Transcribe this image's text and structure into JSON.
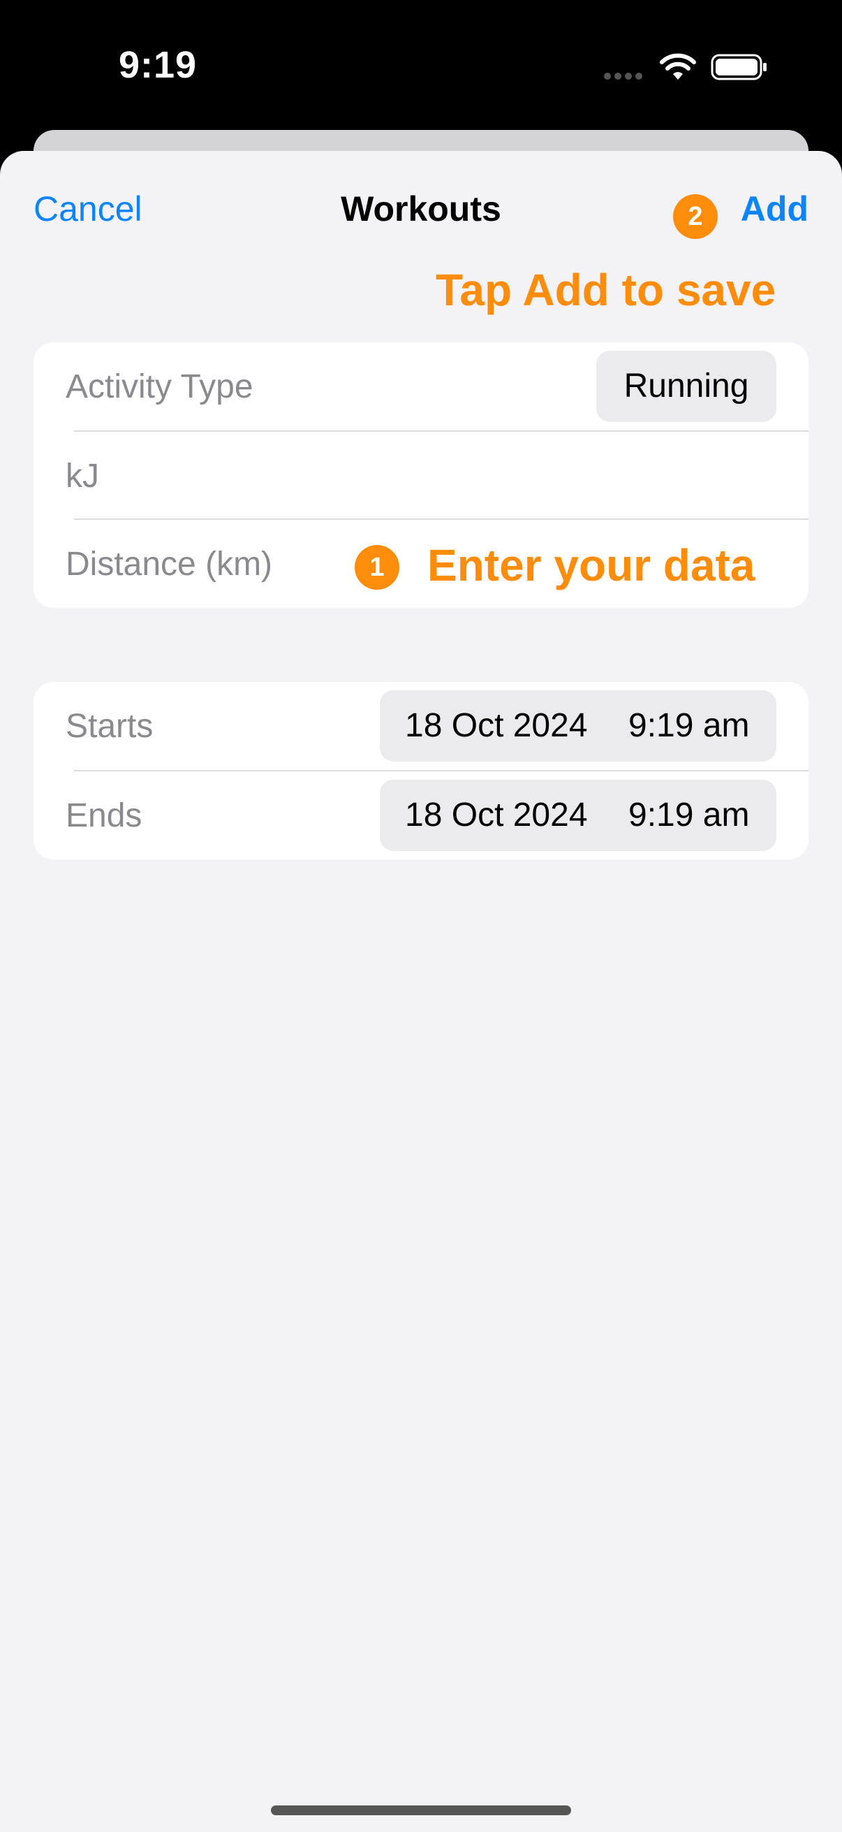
{
  "status_bar": {
    "time": "9:19"
  },
  "nav": {
    "cancel_label": "Cancel",
    "title": "Workouts",
    "add_label": "Add"
  },
  "annotations": {
    "step2_number": "2",
    "step2_text": "Tap Add to save",
    "step1_number": "1",
    "step1_text": "Enter your data"
  },
  "workout_fields": {
    "activity_type_label": "Activity Type",
    "activity_type_value": "Running",
    "energy_label": "kJ",
    "distance_label": "Distance (km)"
  },
  "schedule": {
    "starts_label": "Starts",
    "starts_date": "18 Oct 2024",
    "starts_time": "9:19 am",
    "ends_label": "Ends",
    "ends_date": "18 Oct 2024",
    "ends_time": "9:19 am"
  },
  "colors": {
    "accent_blue": "#0a84ff",
    "annotation_orange": "#ff8c0a",
    "background": "#f2f2f7"
  },
  "icons": {
    "wifi": "wifi-icon",
    "battery": "battery-icon",
    "signal": "signal-dots-icon"
  }
}
